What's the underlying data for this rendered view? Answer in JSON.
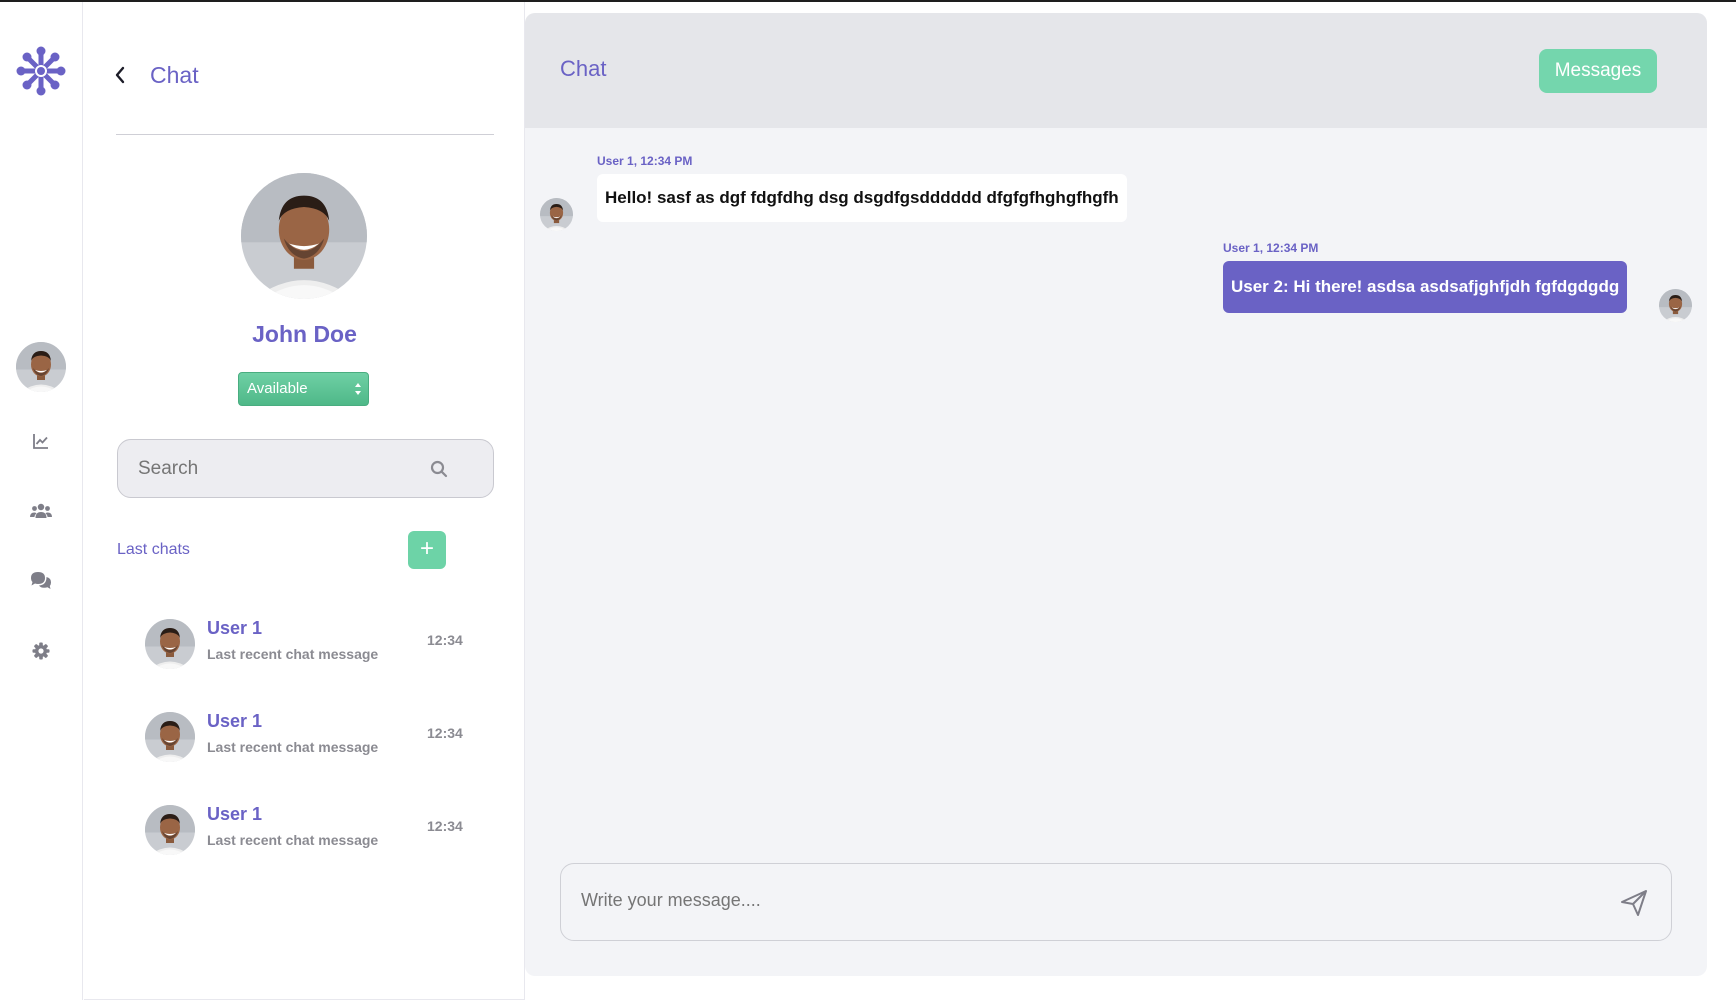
{
  "panel": {
    "title": "Chat",
    "profile_name": "John Doe",
    "status": "Available",
    "search_placeholder": "Search",
    "last_chats_label": "Last chats",
    "add_label": "+",
    "chats": [
      {
        "name": "User 1",
        "message": "Last recent chat message",
        "time": "12:34"
      },
      {
        "name": "User 1",
        "message": "Last recent chat message",
        "time": "12:34"
      },
      {
        "name": "User 1",
        "message": "Last recent chat message",
        "time": "12:34"
      }
    ]
  },
  "main": {
    "title": "Chat",
    "messages_button": "Messages",
    "messages": [
      {
        "meta": "User 1, 12:34 PM",
        "text": "Hello! sasf as dgf fdgfdhg dsg dsgdfgsdddddd dfgfgfhghgfhgfh",
        "direction": "incoming"
      },
      {
        "meta": "User 1, 12:34 PM",
        "text": "User 2: Hi there! asdsa asdsafjghfjdh fgfdgdgdg",
        "direction": "outgoing"
      }
    ],
    "composer_placeholder": "Write your message...."
  },
  "colors": {
    "accent": "#6a62c5",
    "green": "#6dd3a7",
    "header_bg": "#e5e6ea",
    "chat_bg": "#f3f4f7"
  },
  "icons": [
    "logo-icon",
    "chart-icon",
    "users-icon",
    "chat-bubbles-icon",
    "gear-icon",
    "back-chevron-icon",
    "search-icon",
    "send-icon"
  ]
}
